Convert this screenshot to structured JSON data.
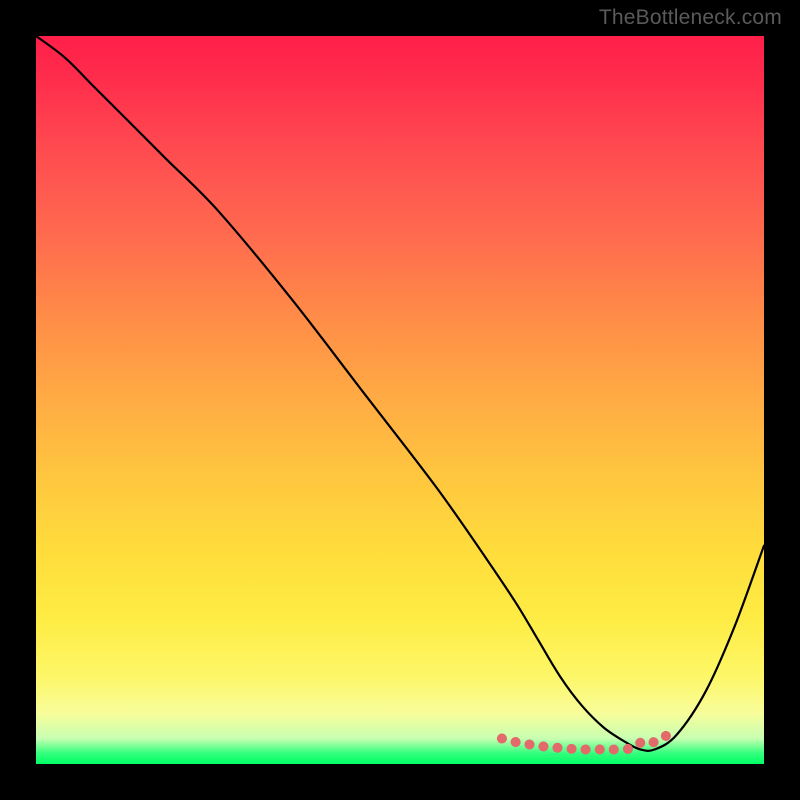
{
  "watermark": "TheBottleneck.com",
  "chart_data": {
    "type": "line",
    "title": "",
    "xlabel": "",
    "ylabel": "",
    "xlim": [
      0,
      100
    ],
    "ylim": [
      0,
      100
    ],
    "series": [
      {
        "name": "bottleneck-curve",
        "x": [
          0,
          4,
          8,
          12,
          18,
          25,
          35,
          45,
          55,
          62,
          66,
          69,
          72,
          75,
          78,
          81,
          83,
          85,
          88,
          92,
          96,
          100
        ],
        "y": [
          100,
          97,
          93,
          89,
          83,
          76,
          64,
          51,
          38,
          28,
          22,
          17,
          12,
          8,
          5,
          3,
          2,
          2,
          4,
          10,
          19,
          30
        ]
      },
      {
        "name": "highlight-segment",
        "x": [
          64,
          66,
          69,
          72,
          75,
          78,
          80,
          82,
          83.5,
          85,
          86,
          87
        ],
        "y": [
          3.5,
          3,
          2.5,
          2.2,
          2,
          2,
          2,
          2.2,
          3.2,
          3,
          3.5,
          4.2
        ]
      }
    ]
  },
  "colors": {
    "curve": "#000000",
    "highlight": "#e26a6a"
  }
}
